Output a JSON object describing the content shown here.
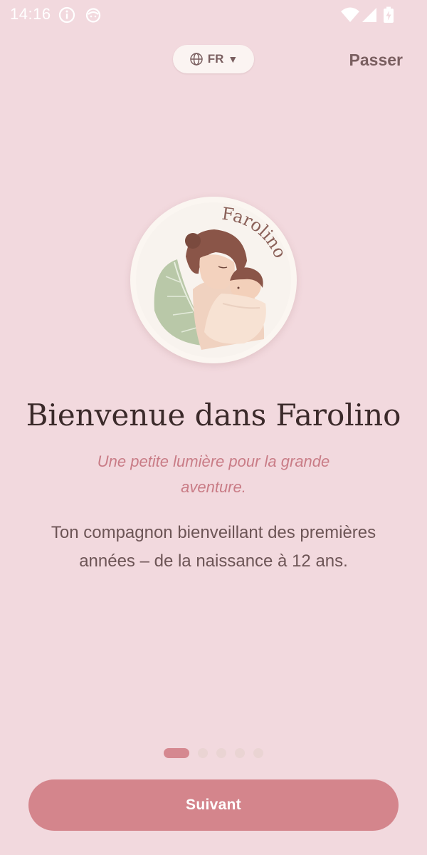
{
  "status_bar": {
    "time": "14:16",
    "icons": [
      "info-icon",
      "android-face-icon",
      "wifi-icon",
      "signal-icon",
      "battery-charging-icon"
    ]
  },
  "header": {
    "language": {
      "code": "FR",
      "icon": "globe-icon",
      "caret": "▼"
    },
    "skip_label": "Passer"
  },
  "logo": {
    "wordmark": "Farolino"
  },
  "content": {
    "title": "Bienvenue dans Farolino",
    "tagline": "Une petite lumière pour la grande aventure.",
    "description": "Ton compagnon bienveillant des premières années – de la naissance à 12 ans."
  },
  "pager": {
    "total": 5,
    "current": 1
  },
  "footer": {
    "next_label": "Suivant"
  },
  "colors": {
    "background": "#f2d9de",
    "accent": "#d4858c",
    "text_primary": "#3b2a2a",
    "text_secondary": "#6d5556",
    "tagline": "#c97c86"
  }
}
